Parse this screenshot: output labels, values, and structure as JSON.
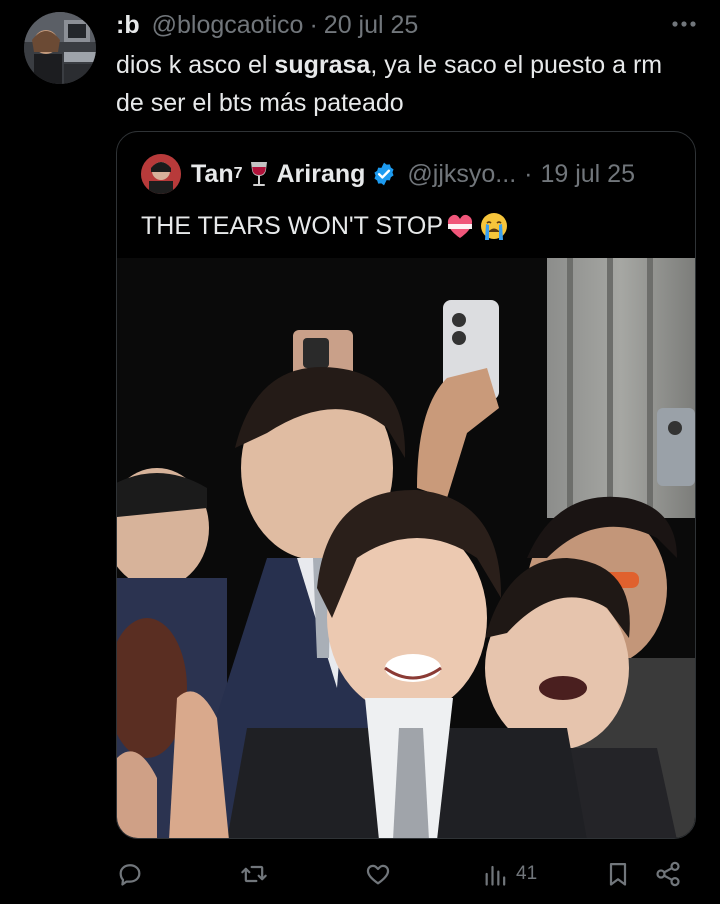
{
  "tweet": {
    "author_name": ":b",
    "handle": "@blogcaotico",
    "separator": "·",
    "date": "20 jul 25",
    "text_before": "dios k asco el ",
    "text_bold": "sugrasa",
    "text_after": ", ya le saco el puesto a rm de ser el bts más pateado"
  },
  "quote": {
    "name_prefix": "Tan",
    "name_superscript": "7",
    "name_suffix": "Arirang",
    "handle": "@jjksyo...",
    "separator": "·",
    "date": "19 jul 25",
    "text": "THE TEARS WON'T STOP"
  },
  "actions": {
    "views": "41"
  },
  "icons": {
    "more": "more-icon",
    "reply": "reply-icon",
    "retweet": "retweet-icon",
    "like": "like-icon",
    "views": "views-icon",
    "bookmark": "bookmark-icon",
    "share": "share-icon"
  },
  "colors": {
    "background": "#000000",
    "text": "#e7e9ea",
    "muted": "#71767b",
    "border": "#2f3336",
    "verified": "#1d9bf0"
  }
}
